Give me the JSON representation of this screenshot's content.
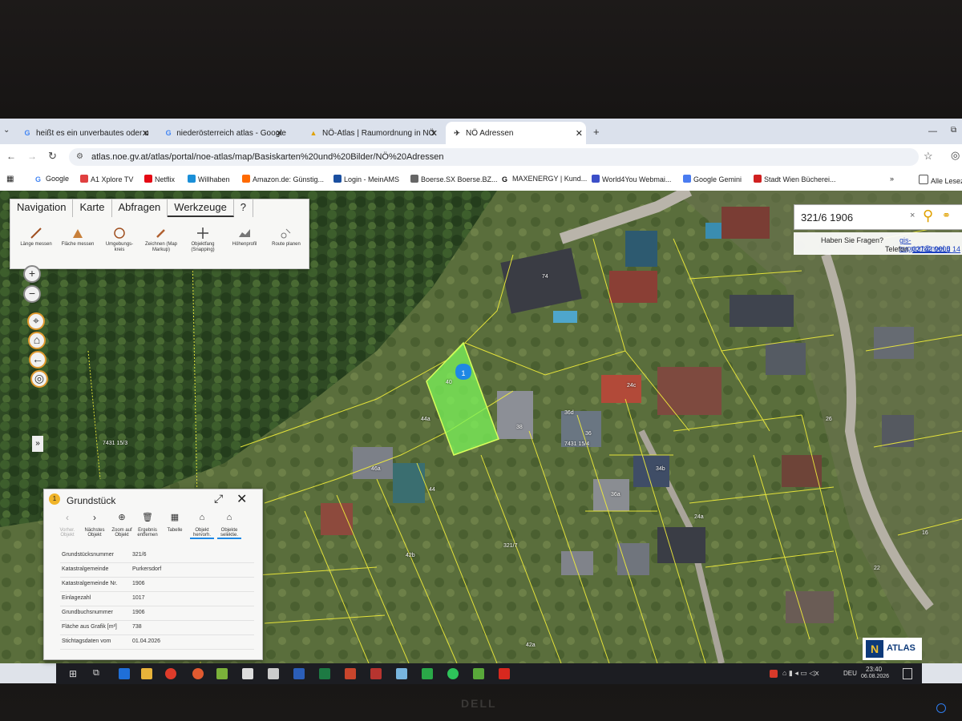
{
  "tabs": [
    {
      "label": "heißt es ein unverbautes oder u"
    },
    {
      "label": "niederösterreich atlas - Google"
    },
    {
      "label": "NÖ-Atlas | Raumordnung in NÖ"
    },
    {
      "label": "NÖ Adressen"
    }
  ],
  "url": "atlas.noe.gv.at/atlas/portal/noe-atlas/map/Basiskarten%20und%20Bilder/NÖ%20Adressen",
  "bookmarks": [
    "Google",
    "A1 Xplore TV",
    "Netflix",
    "Willhaben",
    "Amazon.de: Günstig...",
    "Login - MeinAMS",
    "Boerse.SX Boerse.BZ...",
    "MAXENERGY | Kund...",
    "World4You Webmai...",
    "Google Gemini",
    "Stadt Wien Bücherei..."
  ],
  "bookmarks_other": "Alle Lesez",
  "menu": [
    "Navigation",
    "Karte",
    "Abfragen",
    "Werkzeuge",
    "?"
  ],
  "tools": [
    "Länge messen",
    "Fläche messen",
    "Umgebungs-kreis",
    "Zeichnen (Map Markup)",
    "Objektfang (Snapping)",
    "Höhenprofil",
    "Route planen"
  ],
  "search": {
    "value": "321/6 1906"
  },
  "help": {
    "line1": "Haben Sie Fragen?",
    "email": "gis-support@noel.g",
    "phone_label": "Telefon",
    "phone": "02742 9005 14"
  },
  "panel": {
    "title": "Grundstück",
    "tools": [
      "Vorher. Objekt",
      "Nächstes Objekt",
      "Zoom auf Objekt",
      "Ergebnis entfernen",
      "Tabelle",
      "Objekt hervorh.",
      "Objekte selektie."
    ],
    "rows": [
      {
        "k": "Grundstücksnummer",
        "v": "321/6"
      },
      {
        "k": "Katastralgemeinde",
        "v": "Purkersdorf"
      },
      {
        "k": "Katastralgemeinde Nr.",
        "v": "1906"
      },
      {
        "k": "Einlagezahl",
        "v": "1017"
      },
      {
        "k": "Grundbuchsnummer",
        "v": "1906"
      },
      {
        "k": "Fläche aus Grafik [m²]",
        "v": "738"
      },
      {
        "k": "Stichtagsdaten vom",
        "v": "01.04.2026"
      }
    ]
  },
  "parcels": [
    "74",
    "44a",
    "40",
    "38",
    "36d",
    "36",
    "24c",
    "34b",
    "36a",
    "24a",
    "26",
    "16",
    "44",
    "46a",
    "7431 15/4",
    "7431 15/3",
    "321/7",
    "42b",
    "42a",
    "22"
  ],
  "atlas_logo": "ATLAS",
  "taskbar": {
    "lang": "DEU",
    "time": "23:40",
    "date": "06.08.2026"
  },
  "colors": {
    "parcel_highlight": "#7cf55a",
    "marker": "#1e88e5",
    "parcel_line": "#f3ef3a"
  }
}
